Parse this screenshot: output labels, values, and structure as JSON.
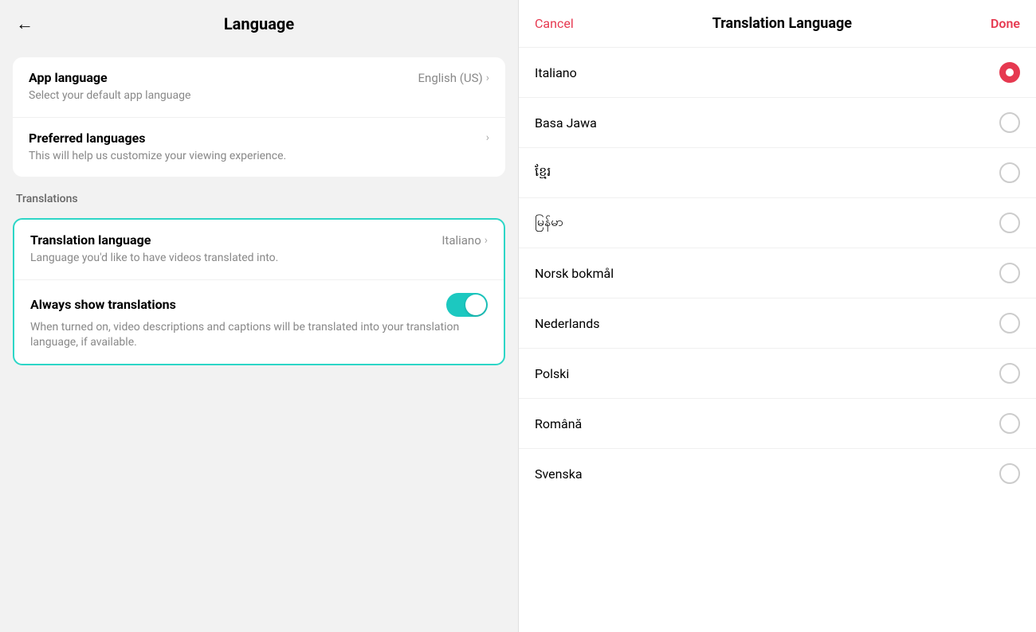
{
  "left": {
    "header": {
      "back_label": "←",
      "title": "Language"
    },
    "app_language_section": {
      "title": "App language",
      "value": "English (US)",
      "subtitle": "Select your default app language"
    },
    "preferred_languages_section": {
      "title": "Preferred languages",
      "subtitle": "This will help us customize your viewing experience."
    },
    "translations_label": "Translations",
    "translation_language_section": {
      "title": "Translation language",
      "value": "Italiano",
      "subtitle": "Language you'd like to have videos translated into."
    },
    "always_show_section": {
      "title": "Always show translations",
      "subtitle": "When turned on, video descriptions and captions will be translated into your translation language, if available."
    }
  },
  "right": {
    "header": {
      "cancel_label": "Cancel",
      "title": "Translation Language",
      "done_label": "Done"
    },
    "languages": [
      {
        "name": "Italiano",
        "selected": true
      },
      {
        "name": "Basa Jawa",
        "selected": false
      },
      {
        "name": "ខ្មែរ",
        "selected": false
      },
      {
        "name": "မြန်မာ",
        "selected": false
      },
      {
        "name": "Norsk bokmål",
        "selected": false
      },
      {
        "name": "Nederlands",
        "selected": false
      },
      {
        "name": "Polski",
        "selected": false
      },
      {
        "name": "Română",
        "selected": false
      },
      {
        "name": "Svenska",
        "selected": false
      }
    ]
  },
  "colors": {
    "accent_red": "#e63950",
    "teal": "#2dd6c7",
    "toggle_bg": "#1cc8c0"
  }
}
